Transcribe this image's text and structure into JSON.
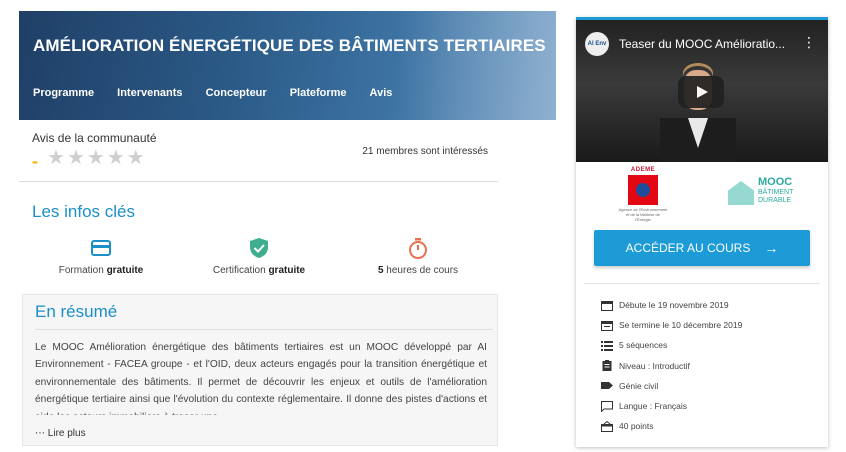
{
  "hero": {
    "title": "AMÉLIORATION ÉNERGÉTIQUE DES BÂTIMENTS TERTIAIRES",
    "nav": [
      "Programme",
      "Intervenants",
      "Concepteur",
      "Plateforme",
      "Avis"
    ]
  },
  "community": {
    "label": "Avis de la communauté",
    "rating_dash": "-",
    "stars_total": 5,
    "interested": "21 membres sont intéressés"
  },
  "infos": {
    "title": "Les infos clés",
    "items": [
      {
        "icon": "credit-card-icon",
        "text": "Formation ",
        "bold": "gratuite",
        "color": "#1c8fc9"
      },
      {
        "icon": "shield-check-icon",
        "text": "Certification ",
        "bold": "gratuite",
        "color": "#3fae8f"
      },
      {
        "icon": "stopwatch-icon",
        "bold": "5",
        "text": " heures de cours",
        "color": "#e8704a"
      }
    ]
  },
  "resume": {
    "title": "En résumé",
    "text": "Le MOOC Amélioration énergétique des bâtiments tertiaires est un MOOC développé par AI Environnement - FACEA groupe - et l'OID, deux acteurs engagés pour la transition énergétique et environnementale des bâtiments. Il permet de découvrir les enjeux et outils de l'amélioration énergétique tertiaire ainsi que l'évolution du contexte réglementaire. Il donne des pistes d'actions et aide les acteurs immobiliers à tracer une",
    "more": "Lire plus"
  },
  "video": {
    "channel": "AI Env",
    "title": "Teaser du MOOC Amélioratio...",
    "menu": "⋮"
  },
  "logos": {
    "ademe_name": "ADEME",
    "ademe_tag": "Agence de l'Environnement et de la Maîtrise de l'Énergie",
    "mooc_line1": "MOOC",
    "mooc_line2": "BÂTIMENT DURABLE"
  },
  "access_button": {
    "label": "ACCÉDER AU COURS",
    "arrow": "→"
  },
  "facts": [
    {
      "icon": "calendar-icon",
      "text": "Débute le 19 novembre 2019"
    },
    {
      "icon": "calendar-end-icon",
      "text": "Se termine le 10 décembre 2019"
    },
    {
      "icon": "list-icon",
      "text": "5 séquences"
    },
    {
      "icon": "clipboard-icon",
      "text": "Niveau : Introductif"
    },
    {
      "icon": "tag-icon",
      "text": "Génie civil"
    },
    {
      "icon": "speech-bubble-icon",
      "text": "Langue : Français"
    },
    {
      "icon": "points-icon",
      "text": "40 points"
    }
  ],
  "colors": {
    "accent": "#1c9bd7",
    "title_blue": "#1c8fc9",
    "star_empty": "#cfcfcf",
    "dash": "#f5b400"
  }
}
